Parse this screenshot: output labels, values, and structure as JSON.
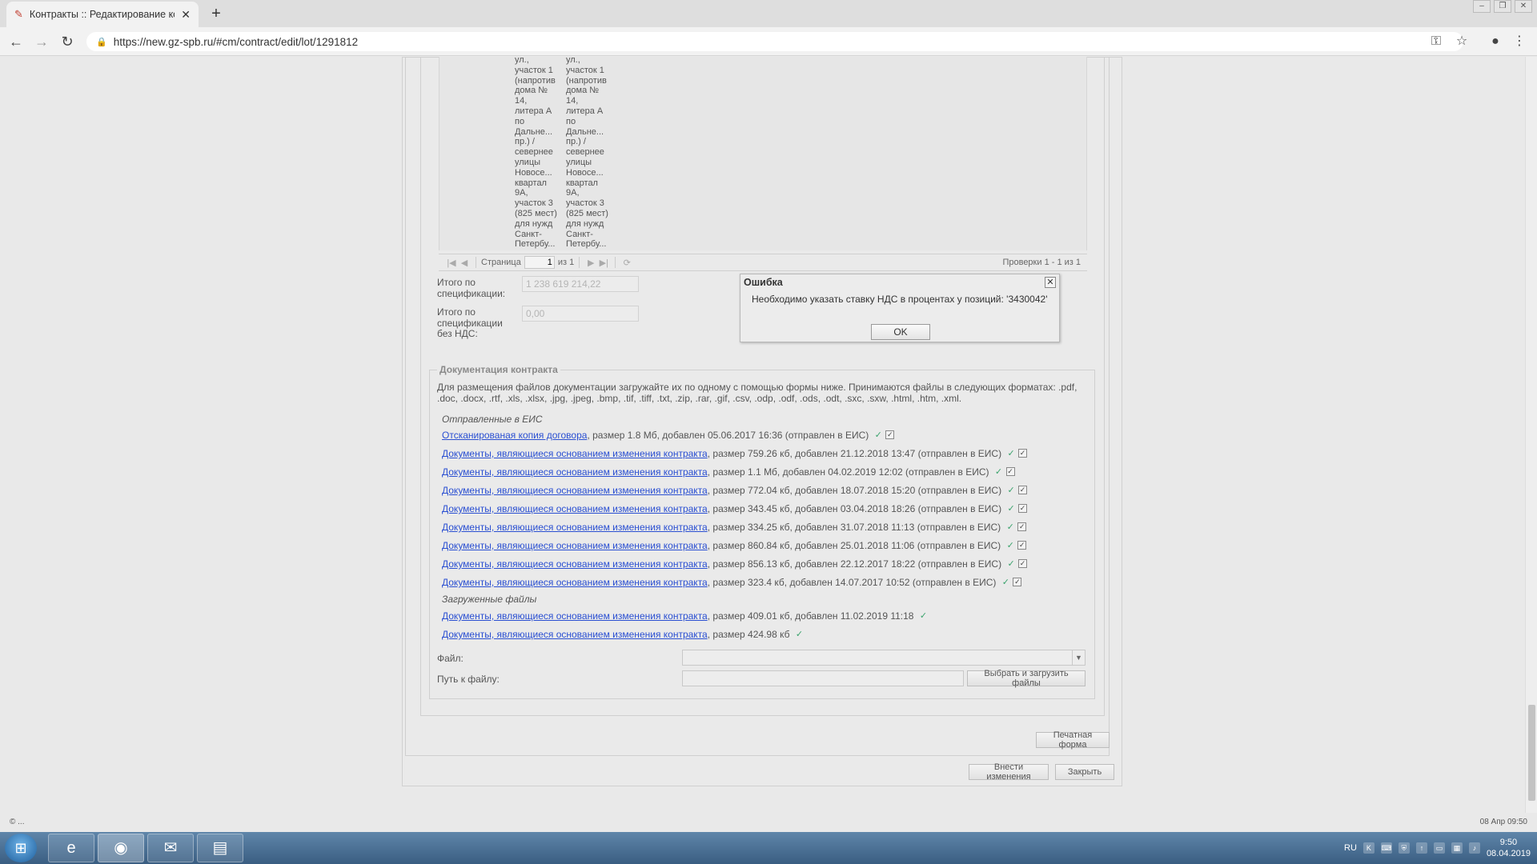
{
  "browser": {
    "tab_title": "Контракты :: Редактирование ко",
    "url": "https://new.gz-spb.ru/#cm/contract/edit/lot/1291812"
  },
  "table": {
    "col1": [
      "ул.,",
      "участок 1",
      "(напротив",
      "дома №",
      "14,",
      "литера А",
      "по",
      "Дальне...",
      "пр.) /",
      "севернее",
      "улицы",
      "Новосе...",
      "квартал",
      "9А,",
      "участок 3",
      "(825 мест)",
      "для нужд",
      "Санкт-",
      "Петербу..."
    ],
    "col2": [
      "ул.,",
      "участок 1",
      "(напротив",
      "дома №",
      "14,",
      "литера А",
      "по",
      "Дальне...",
      "пр.) /",
      "севернее",
      "улицы",
      "Новосе...",
      "квартал",
      "9А,",
      "участок 3",
      "(825 мест)",
      "для нужд",
      "Санкт-",
      "Петербу..."
    ]
  },
  "pager": {
    "page_label": "Страница",
    "page_value": "1",
    "of_label": "из 1",
    "total_label": "Проверки 1 - 1 из 1"
  },
  "totals": {
    "total_label": "Итого по спецификации:",
    "total_value": "1 238 619 214,22",
    "total_no_vat_label": "Итого по спецификации без НДС:",
    "total_no_vat_value": "0,00"
  },
  "docs": {
    "legend": "Документация контракта",
    "note": "Для размещения файлов документации загружайте их по одному с помощью формы ниже. Принимаются файлы в следующих форматах: .pdf, .doc, .docx, .rtf, .xls, .xlsx, .jpg, .jpeg, .bmp, .tif, .tiff, .txt, .zip, .rar, .gif, .csv, .odp, .odf, .ods, .odt, .sxc, .sxw, .html, .htm, .xml.",
    "sent_title": "Отправленные в ЕИС",
    "sent": [
      {
        "link": "Отсканированая копия договора",
        "info": ", размер 1.8 Мб, добавлен 05.06.2017 16:36 (отправлен в ЕИС)"
      },
      {
        "link": "Документы, являющиеся основанием изменения контракта",
        "info": ", размер 759.26 кб, добавлен 21.12.2018 13:47 (отправлен в ЕИС)"
      },
      {
        "link": "Документы, являющиеся основанием изменения контракта",
        "info": ", размер 1.1 Мб, добавлен 04.02.2019 12:02 (отправлен в ЕИС)"
      },
      {
        "link": "Документы, являющиеся основанием изменения контракта",
        "info": ", размер 772.04 кб, добавлен 18.07.2018 15:20 (отправлен в ЕИС)"
      },
      {
        "link": "Документы, являющиеся основанием изменения контракта",
        "info": ", размер 343.45 кб, добавлен 03.04.2018 18:26 (отправлен в ЕИС)"
      },
      {
        "link": "Документы, являющиеся основанием изменения контракта",
        "info": ", размер 334.25 кб, добавлен 31.07.2018 11:13 (отправлен в ЕИС)"
      },
      {
        "link": "Документы, являющиеся основанием изменения контракта",
        "info": ", размер 860.84 кб, добавлен 25.01.2018 11:06 (отправлен в ЕИС)"
      },
      {
        "link": "Документы, являющиеся основанием изменения контракта",
        "info": ", размер 856.13 кб, добавлен 22.12.2017 18:22 (отправлен в ЕИС)"
      },
      {
        "link": "Документы, являющиеся основанием изменения контракта",
        "info": ", размер 323.4 кб, добавлен 14.07.2017 10:52 (отправлен в ЕИС)"
      }
    ],
    "uploaded_title": "Загруженные файлы",
    "uploaded": [
      {
        "link": "Документы, являющиеся основанием изменения контракта",
        "info": ", размер 409.01 кб, добавлен 11.02.2019 11:18"
      },
      {
        "link": "Документы, являющиеся основанием изменения контракта",
        "info": ", размер 424.98 кб"
      }
    ],
    "file_label": "Файл:",
    "path_label": "Путь к файлу:",
    "upload_button": "Выбрать и загрузить файлы"
  },
  "buttons": {
    "print": "Печатная форма",
    "apply": "Внести изменения",
    "close": "Закрыть"
  },
  "dialog": {
    "title": "Ошибка",
    "message": "Необходимо указать ставку НДС в процентах у позиций: '3430042'",
    "ok": "OK"
  },
  "status": {
    "left": "© ...",
    "right": "08 Апр 09:50"
  },
  "taskbar": {
    "lang": "RU",
    "time": "9:50",
    "date": "08.04.2019"
  }
}
